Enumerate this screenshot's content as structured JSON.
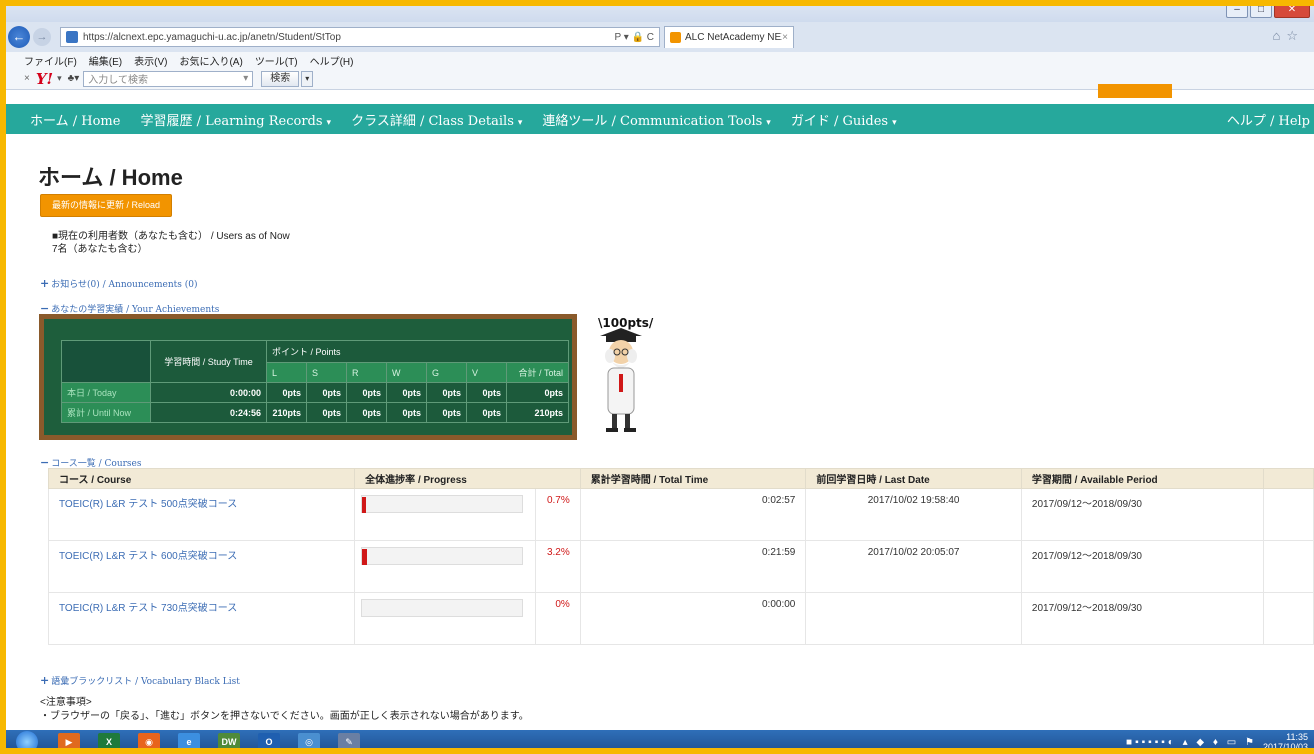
{
  "browser": {
    "url": "https://alcnext.epc.yamaguchi-u.ac.jp/anetn/Student/StTop",
    "url_tools": "P ▾ 🔒 C",
    "tab_label": "ALC NetAcademy NEXT ...",
    "tab_close": "×",
    "menu": [
      "ファイル(F)",
      "編集(E)",
      "表示(V)",
      "お気に入り(A)",
      "ツール(T)",
      "ヘルプ(H)"
    ],
    "toolbar": {
      "close": "×",
      "search_placeholder": "入力して検索",
      "search_button": "検索"
    }
  },
  "nav": {
    "items": [
      {
        "label": "ホーム / Home",
        "caret": ""
      },
      {
        "label": "学習履歴 / Learning Records",
        "caret": "▾"
      },
      {
        "label": "クラス詳細 / Class Details",
        "caret": "▾"
      },
      {
        "label": "連絡ツール / Communication Tools",
        "caret": "▾"
      },
      {
        "label": "ガイド / Guides",
        "caret": "▾"
      }
    ],
    "help": "ヘルプ / Help"
  },
  "page": {
    "title": "ホーム / Home",
    "reload_label": "最新の情報に更新 / Reload",
    "users_heading": "■現在の利用者数（あなたも含む） / Users as of Now",
    "users_count": "7名（あなたも含む）",
    "announcements": "お知らせ(0) / Announcements (0)",
    "achievements_link": "あなたの学習実績 / Your Achievements",
    "courses_link": "コース一覧 / Courses",
    "vocab_link": "語彙ブラックリスト / Vocabulary Black List",
    "notes_heading": "<注意事項>",
    "notes_line1": "・ブラウザーの「戻る」、「進む」ボタンを押さないでください。画面が正しく表示されない場合があります。"
  },
  "achievements": {
    "study_time_header": "学習時間 / Study Time",
    "points_header": "ポイント / Points",
    "sub_headers": [
      "L",
      "S",
      "R",
      "W",
      "G",
      "V",
      "合計 / Total"
    ],
    "rows": [
      {
        "label": "本日 / Today",
        "time": "0:00:00",
        "values": [
          "0pts",
          "0pts",
          "0pts",
          "0pts",
          "0pts",
          "0pts",
          "0pts"
        ]
      },
      {
        "label": "累計 / Until Now",
        "time": "0:24:56",
        "values": [
          "210pts",
          "0pts",
          "0pts",
          "0pts",
          "0pts",
          "0pts",
          "210pts"
        ]
      }
    ],
    "mascot_badge": "100pts"
  },
  "courses": {
    "headers": [
      "コース / Course",
      "全体進捗率 / Progress",
      "累計学習時間 / Total Time",
      "前回学習日時 / Last Date",
      "学習期間 / Available Period"
    ],
    "rows": [
      {
        "name": "TOEIC(R) L&R テスト 500点突破コース",
        "progress": 0.7,
        "progress_label": "0.7%",
        "total_time": "0:02:57",
        "last_date": "2017/10/02 19:58:40",
        "period": "2017/09/12～2018/09/30"
      },
      {
        "name": "TOEIC(R) L&R テスト 600点突破コース",
        "progress": 3.2,
        "progress_label": "3.2%",
        "total_time": "0:21:59",
        "last_date": "2017/10/02 20:05:07",
        "period": "2017/09/12～2018/09/30"
      },
      {
        "name": "TOEIC(R) L&R テスト 730点突破コース",
        "progress": 0,
        "progress_label": "0%",
        "total_time": "0:00:00",
        "last_date": "",
        "period": "2017/09/12～2018/09/30"
      }
    ]
  },
  "taskbar": {
    "time": "11:35",
    "date": "2017/10/03"
  },
  "colors": {
    "nav_teal": "#26a89c",
    "accent_orange": "#f29400",
    "chalkboard_green": "#1e5e3c",
    "progress_red": "#d01818"
  }
}
